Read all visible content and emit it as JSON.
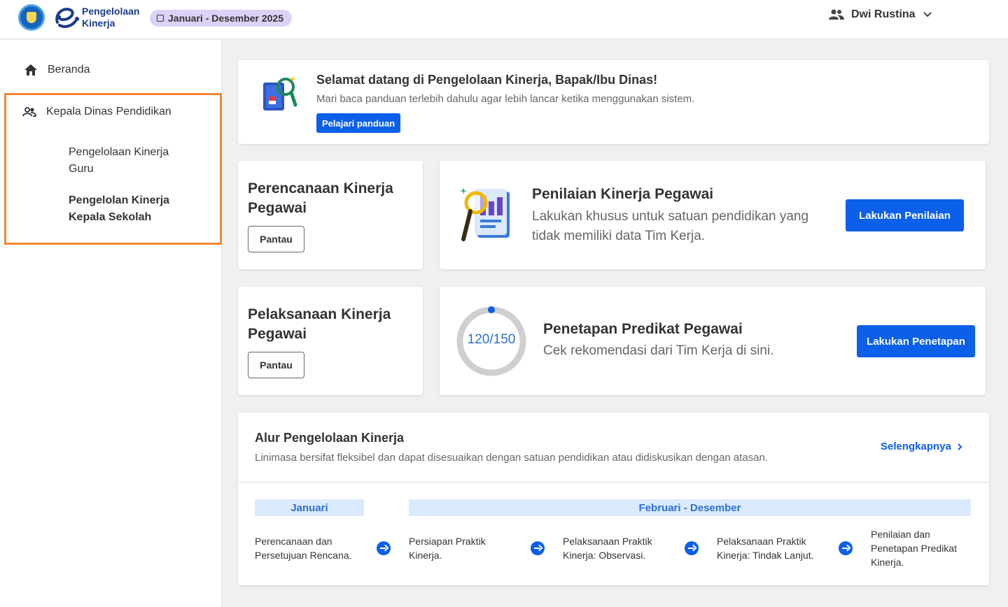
{
  "header": {
    "app_name_line1": "Pengelolaan",
    "app_name_line2": "Kinerja",
    "period": "Januari - Desember 2025",
    "user_name": "Dwi Rustina"
  },
  "sidebar": {
    "home": "Beranda",
    "group": "Kepala Dinas Pendidikan",
    "items": [
      "Pengelolaan Kinerja Guru",
      "Pengelolan Kinerja Kepala Sekolah"
    ]
  },
  "welcome": {
    "title": "Selamat datang di Pengelolaan Kinerja, Bapak/Ibu Dinas!",
    "subtitle": "Mari baca panduan terlebih dahulu agar lebih lancar ketika menggunakan sistem.",
    "button": "Pelajari panduan"
  },
  "plan": {
    "title": "Perencanaan Kinerja Pegawai",
    "button": "Pantau"
  },
  "execution": {
    "title": "Pelaksanaan Kinerja Pegawai",
    "button": "Pantau"
  },
  "assessment": {
    "title": "Penilaian Kinerja Pegawai",
    "subtitle": "Lakukan khusus untuk satuan pendidikan yang tidak memiliki data Tim Kerja.",
    "button": "Lakukan Penilaian"
  },
  "predicate": {
    "progress_label": "120/150",
    "progress_done": 120,
    "progress_total": 150,
    "title": "Penetapan Predikat Pegawai",
    "subtitle": "Cek rekomendasi dari Tim Kerja di sini.",
    "button": "Lakukan Penetapan"
  },
  "flow": {
    "title": "Alur Pengelolaan Kinerja",
    "subtitle": "Linimasa bersifat fleksibel dan dapat disesuaikan dengan satuan pendidikan atau didiskusikan dengan atasan.",
    "more": "Selengkapnya",
    "period_1": "Januari",
    "period_2": "Februari - Desember",
    "steps": [
      "Perencanaan dan Persetujuan Rencana.",
      "Persiapan Praktik Kinerja.",
      "Pelaksanaan Praktik Kinerja: Observasi.",
      "Pelaksanaan Praktik Kinerja: Tindak Lanjut.",
      "Penilaian dan Penetapan Predikat Kinerja."
    ]
  },
  "colors": {
    "primary": "#0b5fe8",
    "highlight": "#f58634",
    "badge": "#dcd2f7",
    "period_bg": "#dbeafc"
  }
}
